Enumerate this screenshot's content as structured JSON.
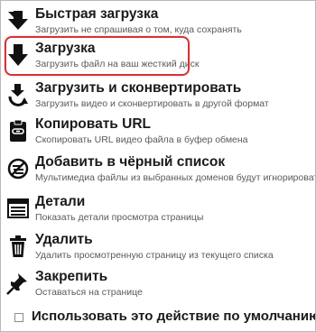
{
  "menu": {
    "items": [
      {
        "title": "Быстрая загрузка",
        "subtitle": "Загрузить не спрашивая о том, куда сохранять",
        "icon": "quick-download-icon"
      },
      {
        "title": "Загрузка",
        "subtitle": "Загрузить файл на ваш жесткий диск",
        "icon": "download-arrow-icon"
      },
      {
        "title": "Загрузить и сконвертировать",
        "subtitle": "Загрузить видео и сконвертировать в другой формат",
        "icon": "convert-icon"
      },
      {
        "title": "Копировать URL",
        "subtitle": "Скопировать URL видео файла в буфер обмена",
        "icon": "clipboard-link-icon"
      },
      {
        "title": "Добавить в чёрный список",
        "subtitle": "Мультимедиа файлы из выбранных доменов будут игнорироваться",
        "icon": "blacklist-icon"
      },
      {
        "title": "Детали",
        "subtitle": "Показать детали просмотра страницы",
        "icon": "details-icon"
      },
      {
        "title": "Удалить",
        "subtitle": "Удалить просмотренную страницу из текущего списка",
        "icon": "trash-icon"
      },
      {
        "title": "Закрепить",
        "subtitle": "Оставаться на странице",
        "icon": "pin-icon"
      }
    ],
    "default_action_label": "Использовать это действие по умолчанию",
    "default_action_checked": false
  },
  "colors": {
    "highlight_border": "#d33434",
    "icon_fill": "#111111"
  }
}
